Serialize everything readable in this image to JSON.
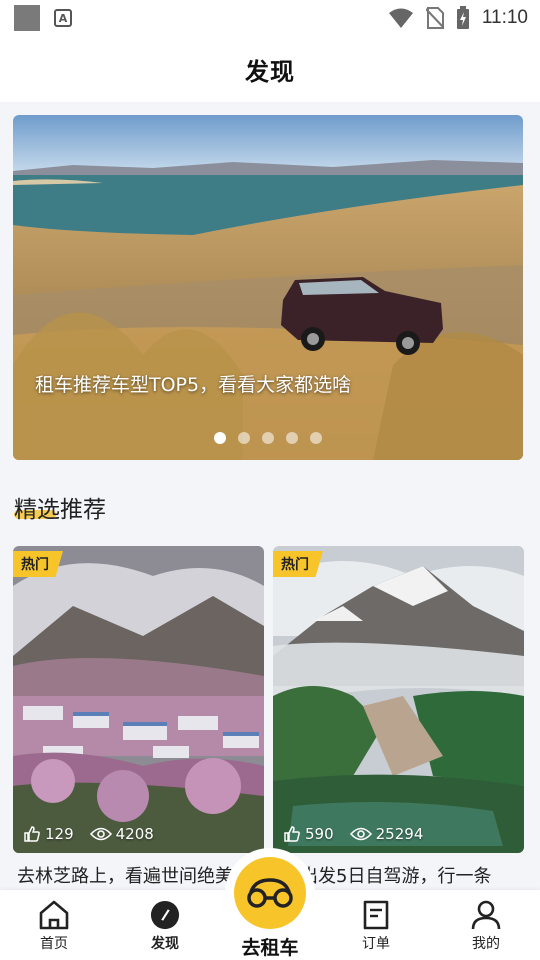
{
  "status_bar": {
    "time": "11:10"
  },
  "header": {
    "title": "发现"
  },
  "banner": {
    "caption": "租车推荐车型TOP5，看看大家都选啥",
    "dot_count": 5,
    "active_dot": 1
  },
  "section": {
    "title": "精选推荐"
  },
  "cards": [
    {
      "tag": "热门",
      "likes": "129",
      "views": "4208",
      "text": "去林芝路上，看遍世间绝美"
    },
    {
      "tag": "热门",
      "likes": "590",
      "views": "25294",
      "text": "出发5日自驾游，行一条"
    }
  ],
  "nav": {
    "home": "首页",
    "discover": "发现",
    "center": "去租车",
    "orders": "订单",
    "mine": "我的"
  },
  "colors": {
    "accent": "#f7c52a",
    "background": "#f4f5f9"
  }
}
